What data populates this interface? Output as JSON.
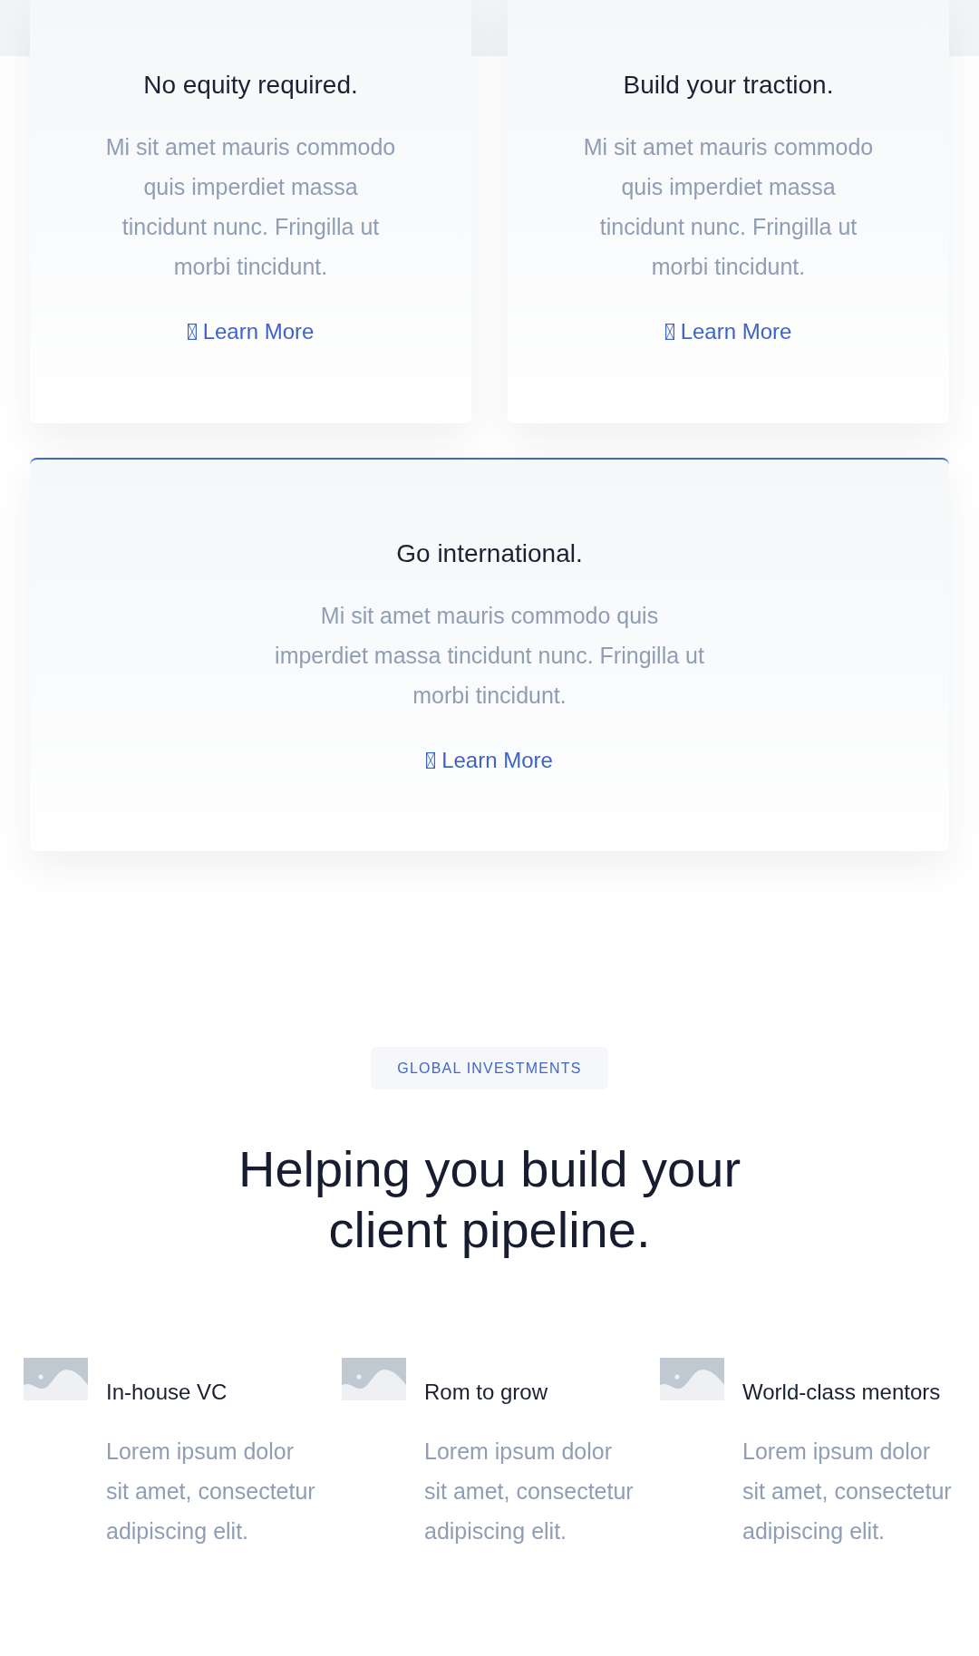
{
  "benefit_cards": [
    {
      "title": "No equity required.",
      "text": "Mi sit amet mauris commodo quis imperdiet massa tincidunt nunc. Fringilla ut morbi tincidunt.",
      "link": "Learn More",
      "highlighted": false
    },
    {
      "title": "Build your traction.",
      "text": "Mi sit amet mauris commodo quis imperdiet massa tincidunt nunc. Fringilla ut morbi tincidunt.",
      "link": "Learn More",
      "highlighted": false
    },
    {
      "title": "Go international.",
      "text": "Mi sit amet mauris commodo quis imperdiet massa tincidunt nunc. Fringilla ut morbi tincidunt.",
      "link": "Learn More",
      "highlighted": true
    }
  ],
  "section": {
    "badge": "GLOBAL INVESTMENTS",
    "heading": "Helping you build your client pipeline."
  },
  "features": [
    {
      "title": "In-house VC",
      "text": "Lorem ipsum dolor sit amet, consectetur adipiscing elit."
    },
    {
      "title": "Rom to grow",
      "text": "Lorem ipsum dolor sit amet, consectetur adipiscing elit."
    },
    {
      "title": "World-class mentors",
      "text": "Lorem ipsum dolor sit amet, consectetur adipiscing elit."
    }
  ]
}
